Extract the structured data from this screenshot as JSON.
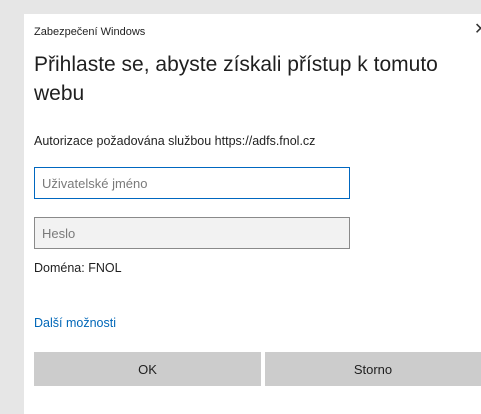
{
  "window": {
    "title": "Zabezpečení Windows",
    "close_glyph": "✕"
  },
  "dialog": {
    "heading": "Přihlaste se, abyste získali přístup k tomuto webu",
    "auth_text": "Autorizace požadována službou https://adfs.fnol.cz",
    "username_placeholder": "Uživatelské jméno",
    "username_value": "",
    "password_placeholder": "Heslo",
    "domain_text": "Doména: FNOL",
    "more_options": "Další možnosti",
    "ok_label": "OK",
    "cancel_label": "Storno"
  },
  "colors": {
    "accent": "#0067c0",
    "link": "#0067b8",
    "button_bg": "#cccccc",
    "backdrop": "#e6e6e6"
  }
}
